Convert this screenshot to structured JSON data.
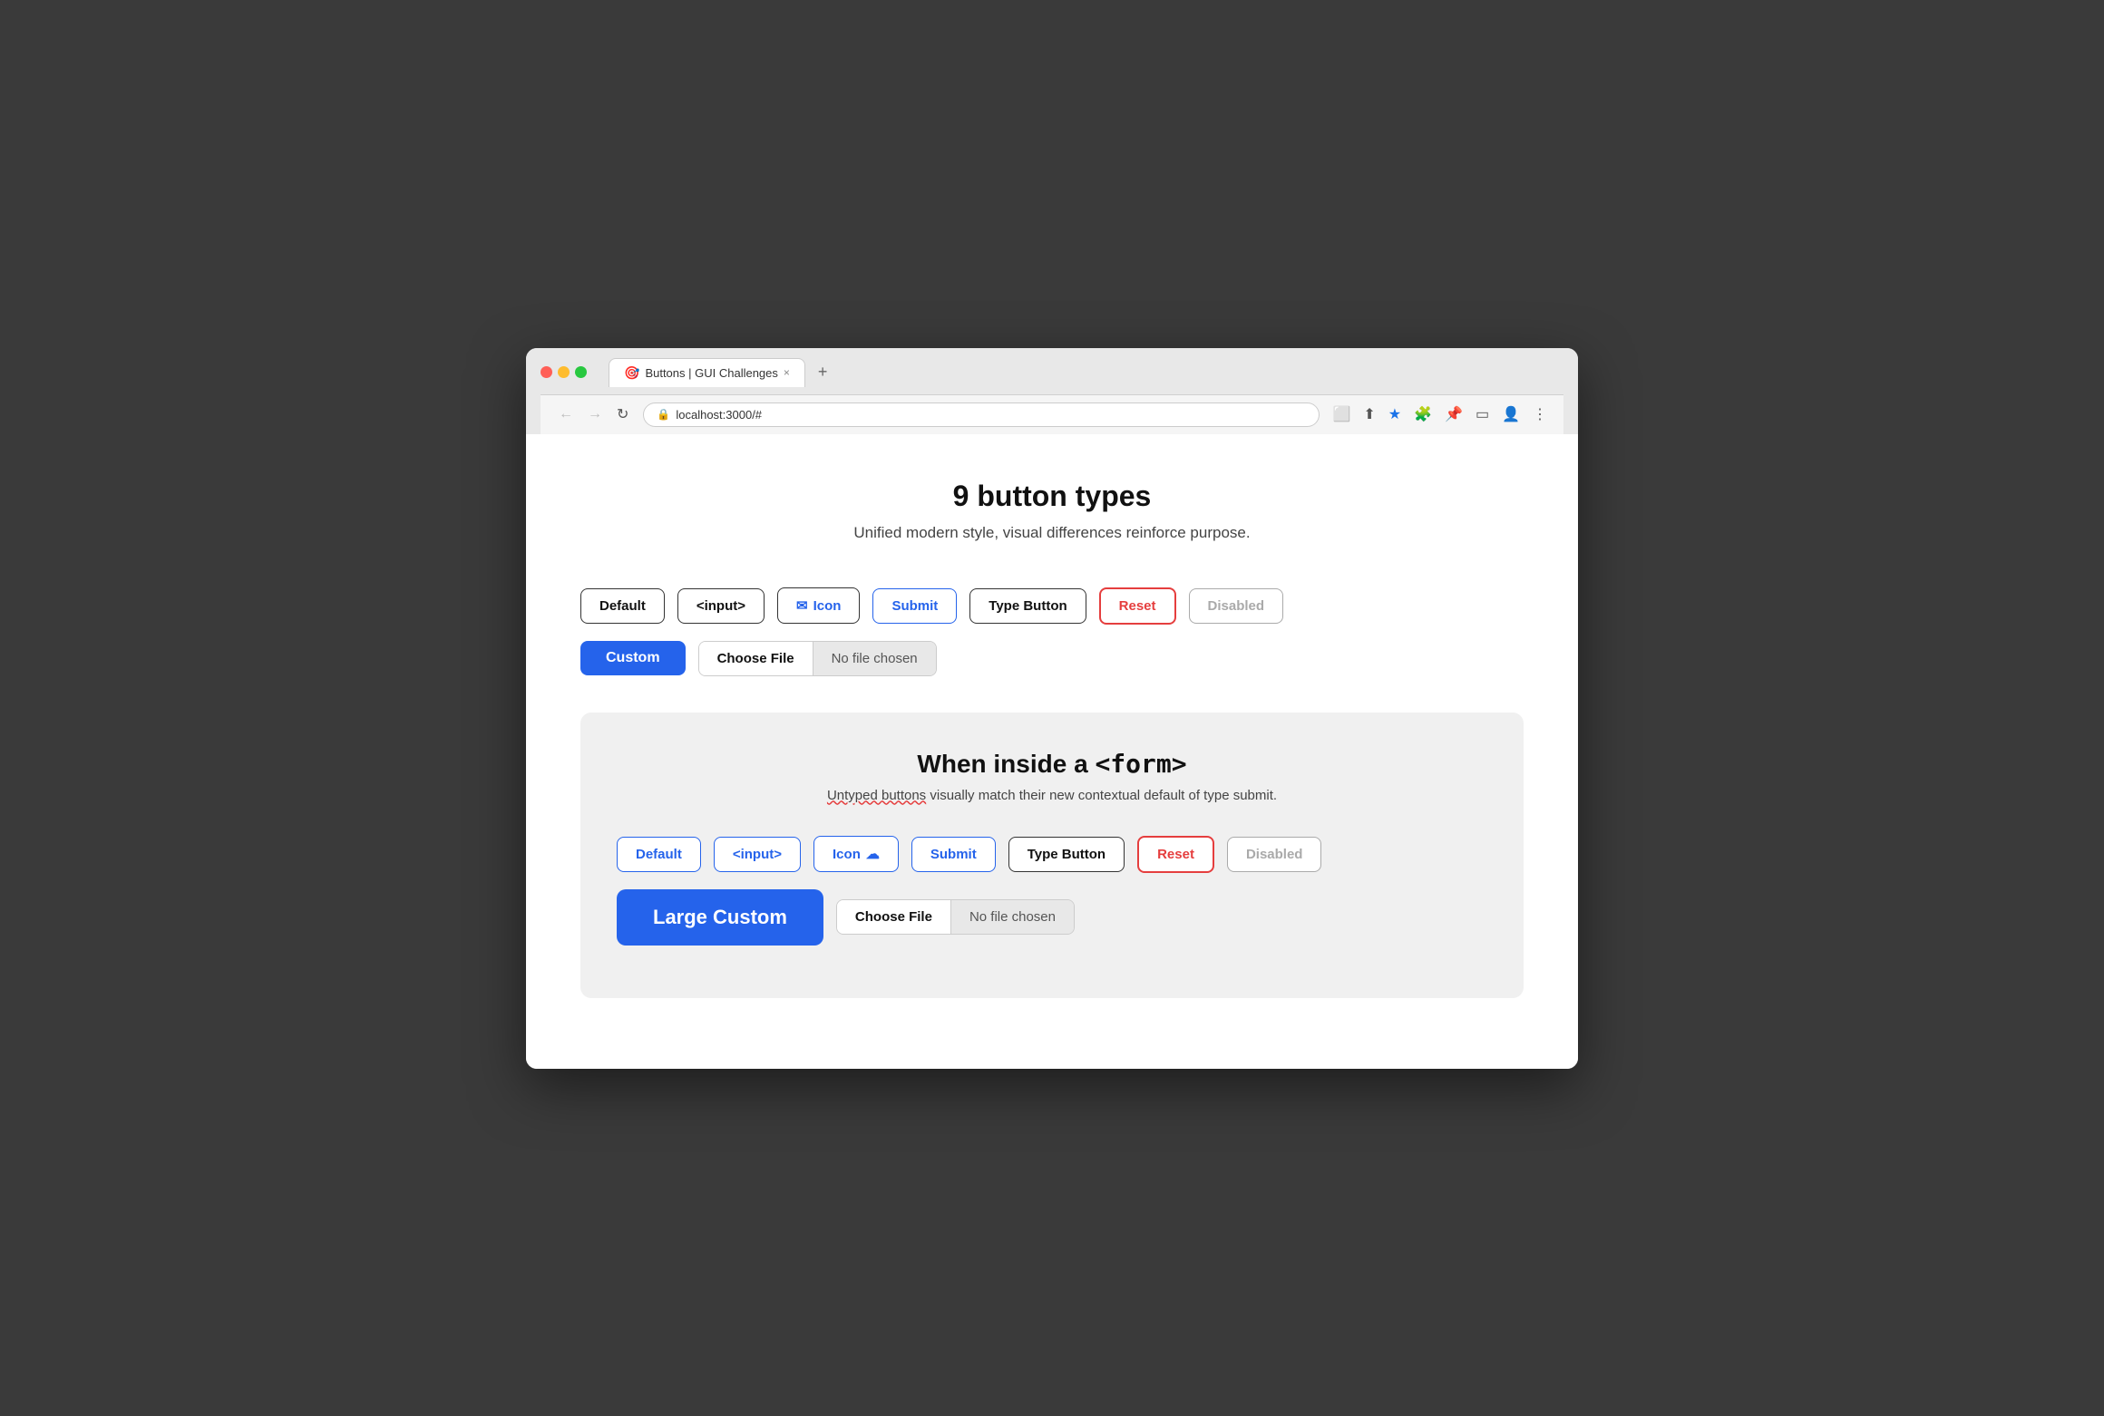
{
  "browser": {
    "traffic_lights": [
      "red",
      "yellow",
      "green"
    ],
    "tab": {
      "icon": "🎯",
      "label": "Buttons | GUI Challenges",
      "close": "×"
    },
    "new_tab": "+",
    "address": "localhost:3000/#",
    "lock_icon": "🔒",
    "nav": {
      "back": "←",
      "forward": "→",
      "refresh": "↻"
    }
  },
  "page": {
    "title": "9 button types",
    "subtitle": "Unified modern style, visual differences reinforce purpose.",
    "buttons_row1": [
      {
        "id": "default",
        "label": "Default",
        "style": "default"
      },
      {
        "id": "input",
        "label": "<input>",
        "style": "input"
      },
      {
        "id": "icon",
        "label": "Icon",
        "style": "icon",
        "icon": "✉"
      },
      {
        "id": "submit",
        "label": "Submit",
        "style": "submit"
      },
      {
        "id": "type-button",
        "label": "Type Button",
        "style": "type-button"
      },
      {
        "id": "reset",
        "label": "Reset",
        "style": "reset"
      },
      {
        "id": "disabled",
        "label": "Disabled",
        "style": "disabled"
      }
    ],
    "buttons_row2": {
      "custom": {
        "label": "Custom",
        "style": "custom"
      },
      "file": {
        "choose_label": "Choose File",
        "no_file_label": "No file chosen"
      }
    },
    "form_section": {
      "title_prefix": "When inside a ",
      "title_tag": "<form>",
      "subtitle_untyped": "Untyped buttons",
      "subtitle_rest": " visually match their new contextual default of type submit.",
      "buttons_row1": [
        {
          "id": "form-default",
          "label": "Default",
          "style": "form-default"
        },
        {
          "id": "form-input",
          "label": "<input>",
          "style": "form-input"
        },
        {
          "id": "form-icon",
          "label": "Icon",
          "style": "form-icon",
          "icon": "☁"
        },
        {
          "id": "form-submit",
          "label": "Submit",
          "style": "form-submit"
        },
        {
          "id": "form-type",
          "label": "Type Button",
          "style": "form-type"
        },
        {
          "id": "form-reset",
          "label": "Reset",
          "style": "form-reset"
        },
        {
          "id": "form-disabled",
          "label": "Disabled",
          "style": "form-disabled"
        }
      ],
      "buttons_row2": {
        "large_custom": {
          "label": "Large Custom",
          "style": "large-custom"
        },
        "file": {
          "choose_label": "Choose File",
          "no_file_label": "No file chosen"
        }
      }
    }
  }
}
